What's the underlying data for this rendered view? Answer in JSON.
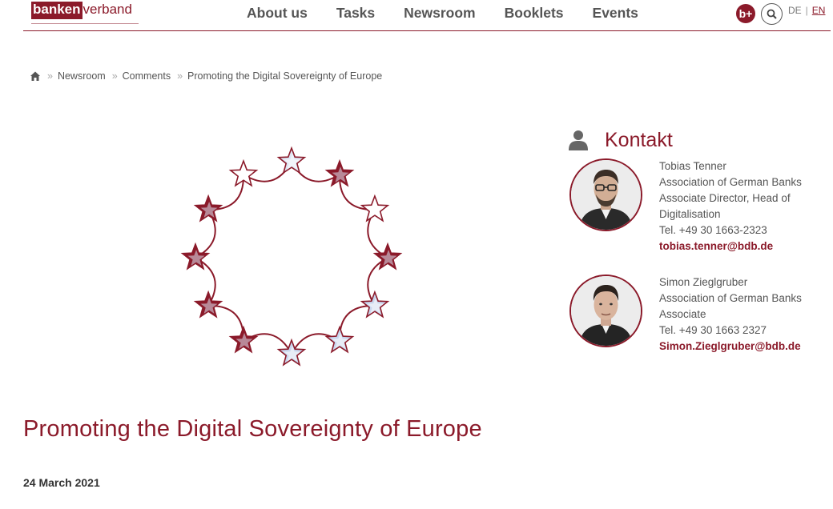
{
  "header": {
    "logo_part1": "banken",
    "logo_part2": "verband",
    "nav": [
      "About us",
      "Tasks",
      "Newsroom",
      "Booklets",
      "Events"
    ],
    "bplus_label": "b+",
    "lang": {
      "de": "DE",
      "sep": "|",
      "en": "EN"
    },
    "accent": "#8b1a2a"
  },
  "breadcrumb": {
    "items": [
      "Newsroom",
      "Comments",
      "Promoting the Digital Sovereignty of Europe"
    ],
    "separator": "»"
  },
  "contact": {
    "title": "Kontakt",
    "people": [
      {
        "name": "Tobias Tenner",
        "org": "Association of German Banks",
        "role_line1": "Associate Director, Head of",
        "role_line2": "Digitalisation",
        "tel": "Tel. +49 30 1663-2323",
        "email": "tobias.tenner@bdb.de"
      },
      {
        "name": "Simon Zieglgruber",
        "org": "Association of German Banks",
        "role_line1": "Associate",
        "tel": "Tel. +49 30 1663 2327",
        "email": "Simon.Zieglgruber@bdb.de"
      }
    ]
  },
  "article": {
    "title": "Promoting the Digital Sovereignty of Europe",
    "date": "24 March 2021"
  }
}
